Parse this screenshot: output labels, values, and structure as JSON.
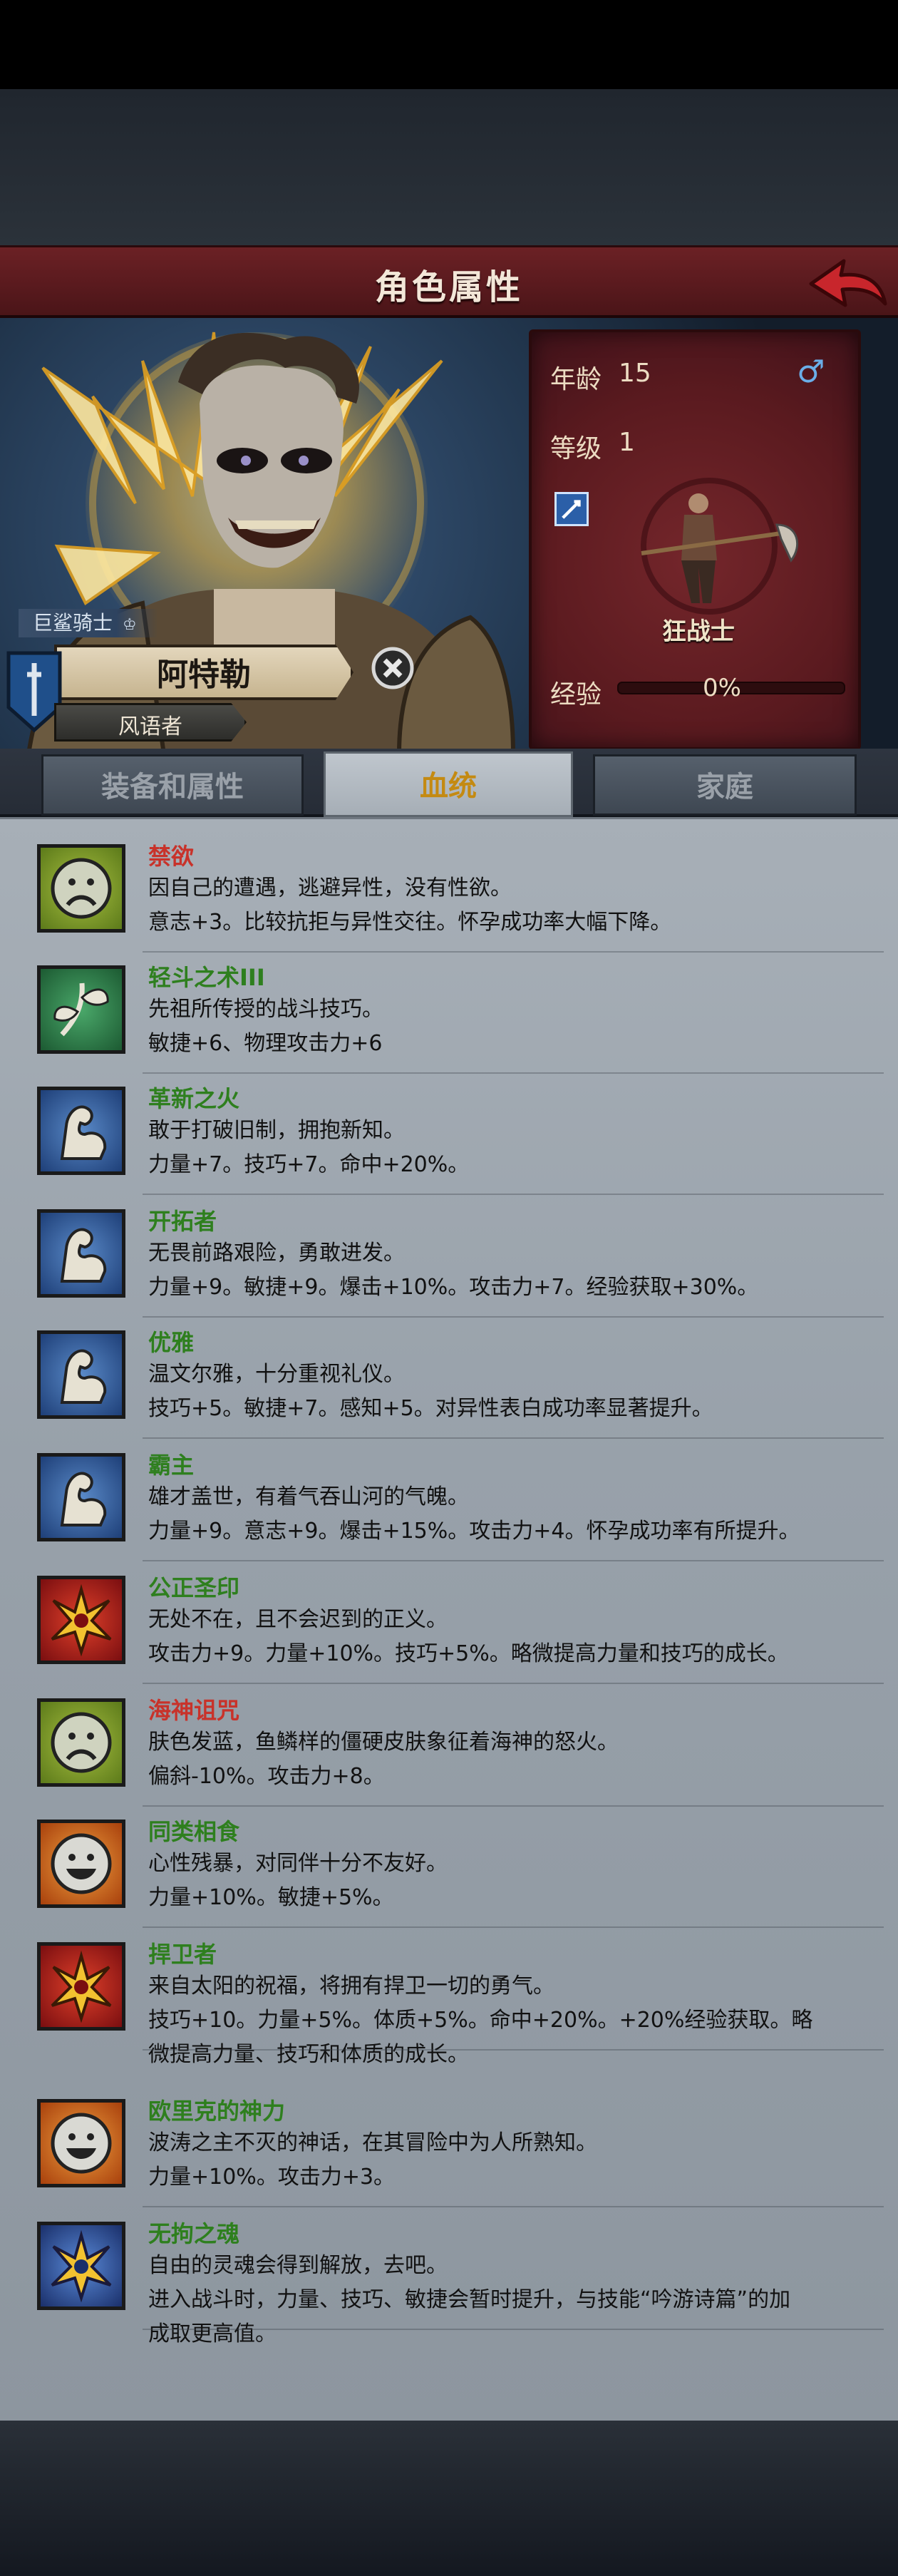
{
  "header": {
    "title": "角色属性"
  },
  "character": {
    "title": "巨鲨骑士",
    "name": "阿特勒",
    "subtitle": "风语者",
    "class_name": "狂战士"
  },
  "stats": {
    "age_label": "年龄",
    "age_value": "15",
    "gender_symbol": "♂",
    "level_label": "等级",
    "level_value": "1",
    "exp_label": "经验",
    "exp_value": "0%",
    "exp_fraction": 0
  },
  "tabs": [
    {
      "label": "装备和属性",
      "active": false
    },
    {
      "label": "血统",
      "active": true
    },
    {
      "label": "家庭",
      "active": false
    }
  ],
  "colors": {
    "red_name": "#c8322a",
    "green_name": "#2e7f1e"
  },
  "traits": [
    {
      "name": "禁欲",
      "color": "red",
      "icon": "sad-face-icon",
      "lines": [
        "因自己的遭遇，逃避异性，没有性欲。",
        "意志+3。比较抗拒与异性交往。怀孕成功率大幅下降。"
      ]
    },
    {
      "name": "轻斗之术III",
      "color": "green",
      "icon": "leaf-sprout-icon",
      "lines": [
        "先祖所传授的战斗技巧。",
        "敏捷+6、物理攻击力+6"
      ]
    },
    {
      "name": "革新之火",
      "color": "green",
      "icon": "flexed-arm-icon",
      "lines": [
        "敢于打破旧制，拥抱新知。",
        "力量+7。技巧+7。命中+20%。"
      ]
    },
    {
      "name": "开拓者",
      "color": "green",
      "icon": "flexed-arm-icon",
      "lines": [
        "无畏前路艰险，勇敢进发。",
        "力量+9。敏捷+9。爆击+10%。攻击力+7。经验获取+30%。"
      ]
    },
    {
      "name": "优雅",
      "color": "green",
      "icon": "flexed-arm-icon",
      "lines": [
        "温文尔雅，十分重视礼仪。",
        "技巧+5。敏捷+7。感知+5。对异性表白成功率显著提升。"
      ]
    },
    {
      "name": "霸主",
      "color": "green",
      "icon": "flexed-arm-icon",
      "lines": [
        "雄才盖世，有着气吞山河的气魄。",
        "力量+9。意志+9。爆击+15%。攻击力+4。怀孕成功率有所提升。"
      ]
    },
    {
      "name": "公正圣印",
      "color": "green",
      "icon": "golden-sigil-icon",
      "lines": [
        "无处不在，且不会迟到的正义。",
        "攻击力+9。力量+10%。技巧+5%。略微提高力量和技巧的成长。"
      ]
    },
    {
      "name": "海神诅咒",
      "color": "red",
      "icon": "sad-face-icon",
      "lines": [
        "肤色发蓝，鱼鳞样的僵硬皮肤象征着海神的怒火。",
        "偏斜-10%。攻击力+8。"
      ]
    },
    {
      "name": "同类相食",
      "color": "green",
      "icon": "smiley-face-icon",
      "lines": [
        "心性残暴，对同伴十分不友好。",
        "力量+10%。敏捷+5%。"
      ]
    },
    {
      "name": "捍卫者",
      "color": "green",
      "icon": "golden-sigil-icon",
      "lines": [
        "来自太阳的祝福，将拥有捍卫一切的勇气。",
        "技巧+10。力量+5%。体质+5%。命中+20%。+20%经验获取。略",
        "微提高力量、技巧和体质的成长。"
      ]
    },
    {
      "name": "欧里克的神力",
      "color": "green",
      "icon": "smiley-face-icon",
      "lines": [
        "波涛之主不灭的神话，在其冒险中为人所熟知。",
        "力量+10%。攻击力+3。"
      ]
    },
    {
      "name": "无拘之魂",
      "color": "green",
      "icon": "blue-sigil-icon",
      "lines": [
        "自由的灵魂会得到解放，去吧。",
        "进入战斗时，力量、技巧、敏捷会暂时提升，与技能“吟游诗篇”的加",
        "成取更高值。"
      ]
    }
  ]
}
